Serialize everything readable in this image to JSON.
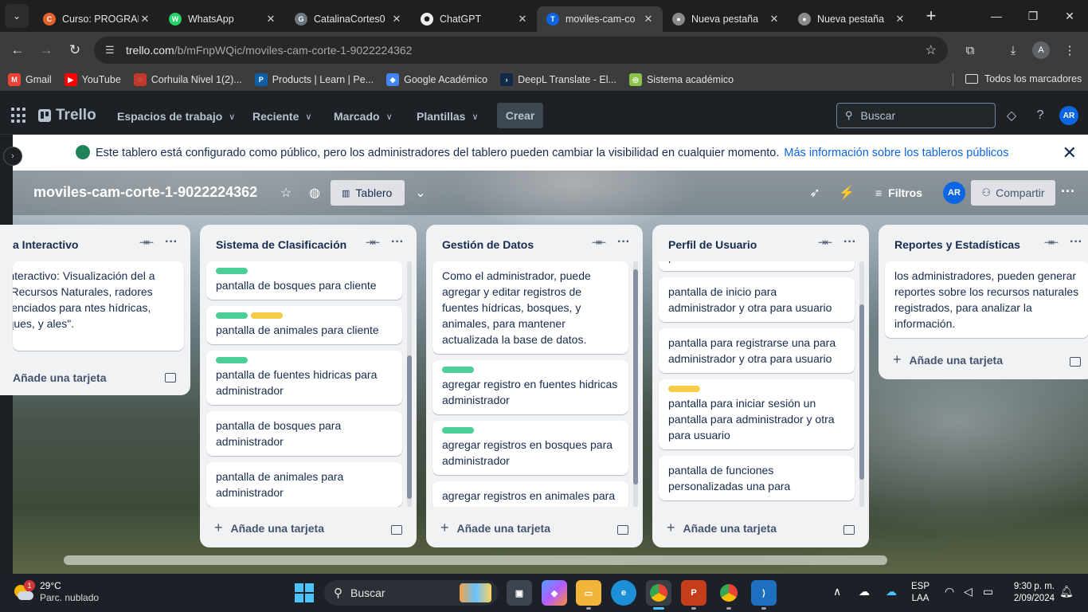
{
  "browser": {
    "tabs": [
      {
        "title": "Curso: PROGRAM",
        "icon": "coursera-icon",
        "color": "#e2622b",
        "glyph": "C"
      },
      {
        "title": "WhatsApp",
        "icon": "whatsapp-icon",
        "color": "#25d366",
        "glyph": "W"
      },
      {
        "title": "CatalinaCortes0",
        "icon": "github-icon",
        "color": "#6e7681",
        "glyph": "G"
      },
      {
        "title": "ChatGPT",
        "icon": "chatgpt-icon",
        "color": "#f0f0f0",
        "glyph": "✺"
      },
      {
        "title": "moviles-cam-co",
        "icon": "trello-icon",
        "color": "#0c66e4",
        "glyph": "T",
        "active": true
      },
      {
        "title": "Nueva pestaña",
        "icon": "chrome-icon",
        "color": "#8a8a8a",
        "glyph": "●"
      },
      {
        "title": "Nueva pestaña",
        "icon": "chrome-icon",
        "color": "#8a8a8a",
        "glyph": "●"
      }
    ],
    "url_host": "trello.com",
    "url_path": "/b/mFnpWQic/moviles-cam-corte-1-9022224362",
    "profile_initial": "A",
    "bookmarks": [
      {
        "label": "Gmail",
        "icon": "gmail-icon",
        "color": "#ea4335",
        "glyph": "M"
      },
      {
        "label": "YouTube",
        "icon": "youtube-icon",
        "color": "#ff0000",
        "glyph": "▶"
      },
      {
        "label": "Corhuila Nivel 1(2)...",
        "icon": "corhuila-icon",
        "color": "#c0392b",
        "glyph": "◌"
      },
      {
        "label": "Products | Learn | Pe...",
        "icon": "pearson-icon",
        "color": "#0b5fa5",
        "glyph": "P"
      },
      {
        "label": "Google Académico",
        "icon": "scholar-icon",
        "color": "#4285f4",
        "glyph": "◆"
      },
      {
        "label": "DeepL Translate - El...",
        "icon": "deepl-icon",
        "color": "#0f2b46",
        "glyph": "›"
      },
      {
        "label": "Sistema académico",
        "icon": "academic-icon",
        "color": "#8bc34a",
        "glyph": "◎"
      }
    ],
    "all_bookmarks": "Todos los marcadores"
  },
  "trello": {
    "logo": "Trello",
    "nav": [
      "Espacios de trabajo",
      "Reciente",
      "Marcado",
      "Plantillas"
    ],
    "create": "Crear",
    "search_placeholder": "Buscar",
    "avatar": "AR"
  },
  "banner": {
    "text": "Este tablero está configurado como público, pero los administradores del tablero pueden cambiar la visibilidad en cualquier momento.",
    "link": "Más información sobre los tableros públicos"
  },
  "board": {
    "title": "moviles-cam-corte-1-9022224362",
    "view": "Tablero",
    "filters": "Filtros",
    "share": "Compartir",
    "member": "AR",
    "add_card": "Añade una tarjeta"
  },
  "lists": [
    {
      "title": "a Interactivo",
      "cards": [
        {
          "labels": [],
          "text": "pa Interactivo: Visualización del a con Recursos Naturales, radores diferenciados para ntes hídricas, bosques, y ales\"."
        }
      ]
    },
    {
      "title": "Sistema de Clasificación",
      "cards": [
        {
          "labels": [
            "green"
          ],
          "text": "pantalla de bosques para cliente"
        },
        {
          "labels": [
            "green",
            "yellow"
          ],
          "text": "pantalla de animales para cliente"
        },
        {
          "labels": [
            "green"
          ],
          "text": "pantalla de fuentes hidricas para administrador"
        },
        {
          "labels": [],
          "text": "pantalla de bosques para administrador"
        },
        {
          "labels": [],
          "text": "pantalla de animales para administrador"
        }
      ]
    },
    {
      "title": "Gestión de Datos",
      "cards": [
        {
          "labels": [],
          "text": "Como el administrador, puede agregar y editar registros de fuentes hídricas, bosques, y animales, para mantener actualizada la base de datos."
        },
        {
          "labels": [
            "green"
          ],
          "text": "agregar registro en fuentes hidricas administrador"
        },
        {
          "labels": [
            "green"
          ],
          "text": "agregar registros en bosques para administrador"
        },
        {
          "labels": [],
          "text": "agregar registros en animales para"
        }
      ]
    },
    {
      "title": "Perfil de Usuario",
      "cards": [
        {
          "labels": [],
          "text": "personalizadas."
        },
        {
          "labels": [],
          "text": "pantalla de inicio para administrador y otra para usuario"
        },
        {
          "labels": [],
          "text": "pantalla para registrarse una para administrador y otra para usuario"
        },
        {
          "labels": [
            "yellow"
          ],
          "text": "pantalla para iniciar sesión un pantalla para administrador y otra para usuario"
        },
        {
          "labels": [],
          "text": "pantalla de funciones personalizadas una para"
        }
      ]
    },
    {
      "title": "Reportes y Estadísticas",
      "cards": [
        {
          "labels": [],
          "text": "los administradores, pueden generar reportes sobre los recursos naturales registrados, para analizar la información."
        }
      ]
    }
  ],
  "taskbar": {
    "weather_temp": "29°C",
    "weather_desc": "Parc. nublado",
    "weather_badge": "1",
    "search": "Buscar",
    "lang1": "ESP",
    "lang2": "LAA",
    "time": "9:30 p. m.",
    "date": "2/09/2024"
  }
}
